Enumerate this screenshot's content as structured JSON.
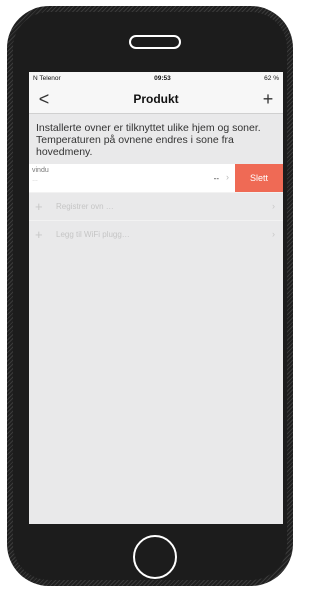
{
  "status": {
    "carrier": "N Telenor",
    "time": "09:53",
    "right": "62 %"
  },
  "nav": {
    "back": "<",
    "title": "Produkt",
    "add": "+"
  },
  "info": {
    "line1": "Installerte ovner er tilknyttet ulike hjem og soner.",
    "line2": "Temperaturen på ovnene endres i sone fra hovedmeny."
  },
  "device": {
    "name": "vindu",
    "sub": "…",
    "value": "--",
    "delete_label": "Slett"
  },
  "actions": [
    {
      "label": "Registrer ovn …"
    },
    {
      "label": "Legg til WiFi plugg…"
    }
  ],
  "icons": {
    "chevron": "›",
    "plus": "+"
  }
}
